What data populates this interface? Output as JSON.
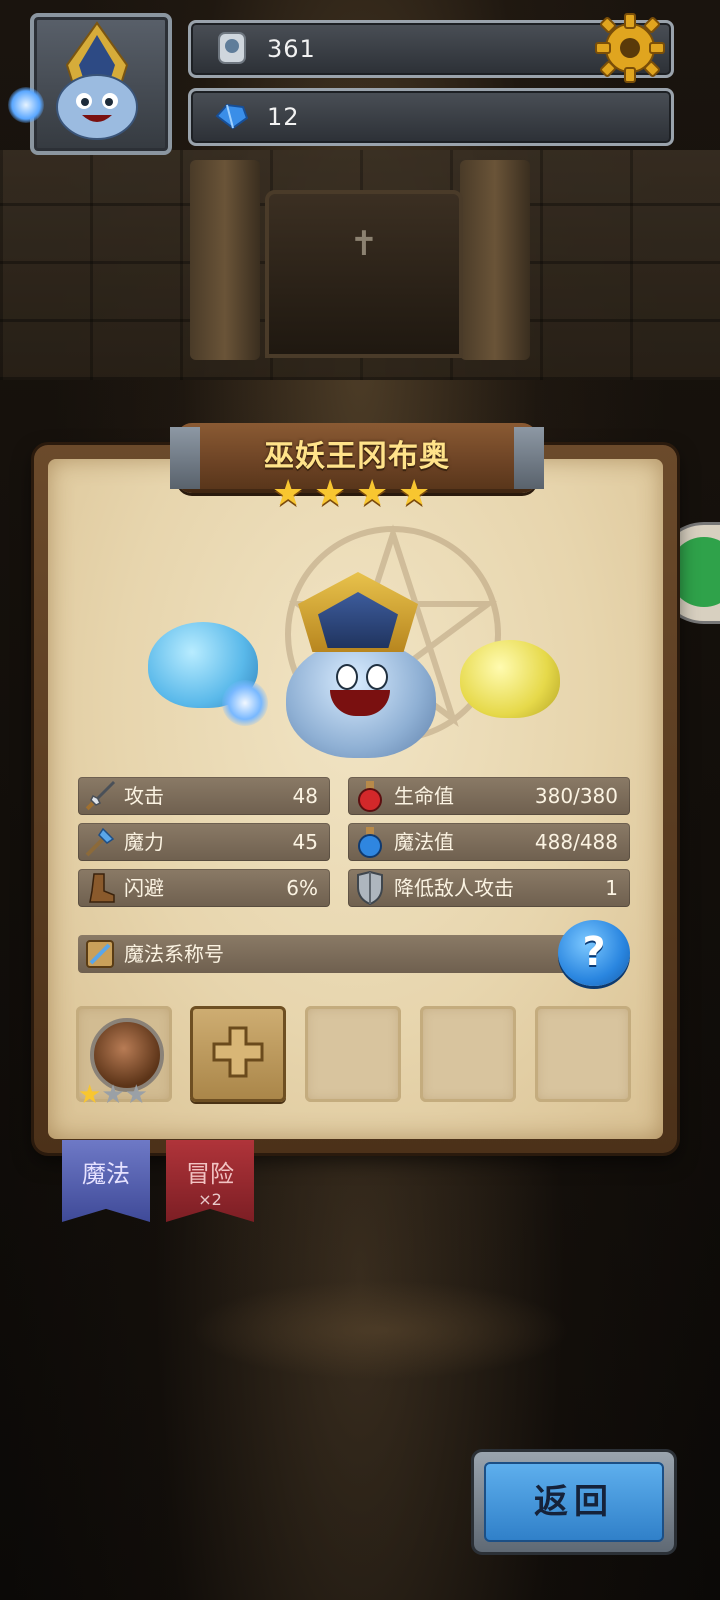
{
  "hud": {
    "currency_1": {
      "icon": "silver-coin-icon",
      "value": "361"
    },
    "currency_2": {
      "icon": "blue-gem-icon",
      "value": "12"
    },
    "settings_icon": "gear-icon"
  },
  "hero": {
    "name": "巫妖王冈布奥",
    "stars": 4
  },
  "stats": [
    {
      "icon": "sword-icon",
      "label": "攻击",
      "value": "48"
    },
    {
      "icon": "health-potion-icon",
      "label": "生命值",
      "value": "380/380"
    },
    {
      "icon": "magic-staff-icon",
      "label": "魔力",
      "value": "45"
    },
    {
      "icon": "mana-potion-icon",
      "label": "魔法值",
      "value": "488/488"
    },
    {
      "icon": "boot-icon",
      "label": "闪避",
      "value": "6%"
    },
    {
      "icon": "shield-icon",
      "label": "降低敌人攻击",
      "value": "1"
    }
  ],
  "title_row": {
    "icon": "magic-title-icon",
    "label": "魔法系称号",
    "help": "?"
  },
  "skill_slots": {
    "slot_1": {
      "filled": true,
      "stars_filled": 1,
      "stars_total": 3
    },
    "slot_2": {
      "add": true
    },
    "empty_count": 3
  },
  "tabs": [
    {
      "label": "魔法",
      "sub": ""
    },
    {
      "label": "冒险",
      "sub": "×2"
    }
  ],
  "back_button": {
    "label": "返回"
  },
  "colors": {
    "title_gold": "#ffe38a",
    "star": "#f8c630",
    "stat_text": "#fbf3e2",
    "tab_magic": "#4f5bb0",
    "tab_adventure": "#9c2a30",
    "back_blue": "#3f93dc"
  }
}
